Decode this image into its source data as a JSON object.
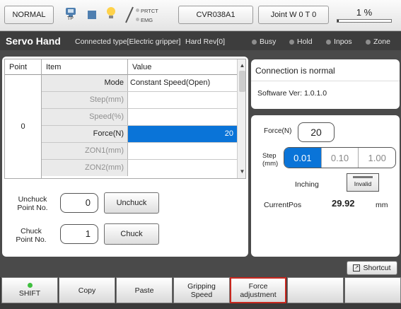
{
  "header": {
    "mode_label": "NORMAL",
    "tp_label": "TP",
    "prtct_label": "PRTCT",
    "emg_label": "EMG",
    "robot_label": "CVR038A1",
    "joint_label": "Joint W 0 T 0",
    "speed_label": "1 %",
    "speed_value": 0.01
  },
  "titlebar": {
    "title": "Servo Hand",
    "connected_type": "Connected type[Electric gripper]",
    "hard_rev": "Hard Rev[0]",
    "status": [
      "Busy",
      "Hold",
      "Inpos",
      "Zone"
    ]
  },
  "table": {
    "headers": [
      "Point",
      "Item",
      "Value"
    ],
    "point": "0",
    "rows": [
      {
        "item": "Mode",
        "value": "Constant Speed(Open)"
      },
      {
        "item": "Step(mm)",
        "value": ""
      },
      {
        "item": "Speed(%)",
        "value": ""
      },
      {
        "item": "Force(N)",
        "value": "20"
      },
      {
        "item": "ZON1(mm)",
        "value": ""
      },
      {
        "item": "ZON2(mm)",
        "value": ""
      }
    ]
  },
  "chuck": {
    "unchuck_label": "Unchuck\nPoint No.",
    "unchuck_point": "0",
    "unchuck_button": "Unchuck",
    "chuck_label": "Chuck\nPoint No.",
    "chuck_point": "1",
    "chuck_button": "Chuck"
  },
  "connection": {
    "status": "Connection is normal",
    "software_version": "Software Ver: 1.0.1.0"
  },
  "force_panel": {
    "force_label": "Force(N)",
    "force_value": "20",
    "step_label": "Step\n(mm)",
    "step_options": [
      "0.01",
      "0.10",
      "1.00"
    ],
    "inching_label": "Inching",
    "inching_button": "Invalid",
    "current_pos_label": "CurrentPos",
    "current_pos_value": "29.92",
    "current_pos_unit": "mm"
  },
  "shortcut_label": "Shortcut",
  "function_keys": [
    "SHIFT",
    "Copy",
    "Paste",
    "Gripping\nSpeed",
    "Force\nadjustment",
    "",
    ""
  ],
  "colors": {
    "accent": "#0a74d8",
    "highlight_border": "#c8281f",
    "shift_led": "#3fbf3f"
  }
}
